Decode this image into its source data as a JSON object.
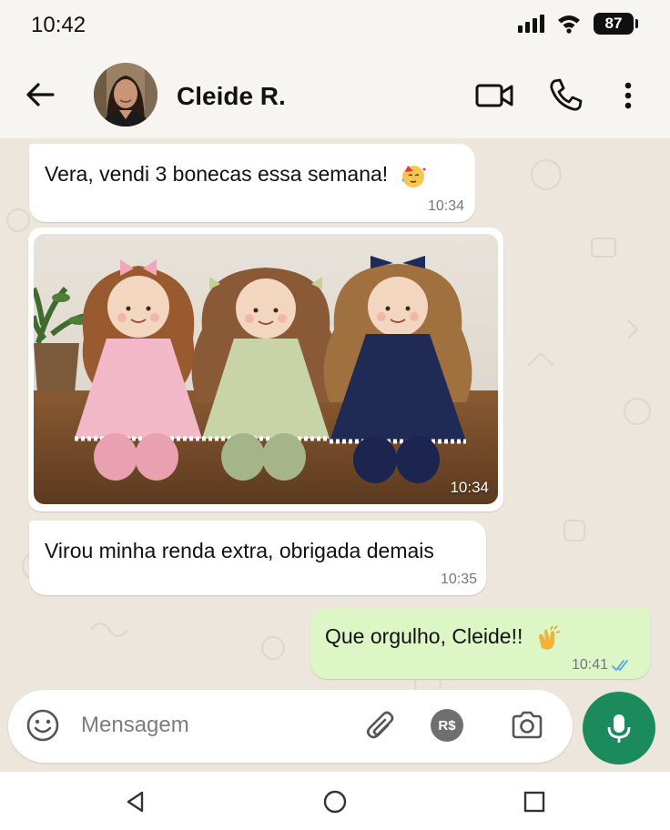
{
  "status_bar": {
    "time": "10:42",
    "battery": "87"
  },
  "header": {
    "contact_name": "Cleide R."
  },
  "messages": [
    {
      "direction": "incoming",
      "text": "Vera, vendi 3 bonecas essa semana!",
      "emoji": "partying-face-emoji",
      "time": "10:34"
    },
    {
      "direction": "incoming",
      "type": "photo",
      "caption_time": "10:34",
      "image": "three handmade rag dolls in pink, green and navy dresses"
    },
    {
      "direction": "incoming",
      "text": "Virou minha renda extra, obrigada demais",
      "time": "10:35"
    },
    {
      "direction": "outgoing",
      "text": "Que orgulho, Cleide!!",
      "emoji": "clapping-hands-emoji",
      "time": "10:41",
      "status": "read"
    }
  ],
  "composer": {
    "placeholder": "Mensagem",
    "payment_label": "R$"
  },
  "colors": {
    "accent": "#1b8a5c",
    "outgoing_bubble": "#dcf7c5",
    "chat_bg": "#ece6dc",
    "read_ticks": "#4fa8e8"
  }
}
